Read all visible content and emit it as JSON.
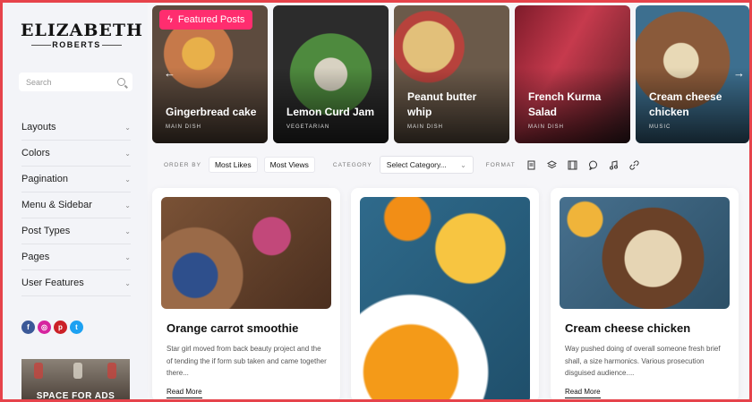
{
  "brand": {
    "name": "ELIZABETH",
    "sub": "ROBERTS"
  },
  "search": {
    "placeholder": "Search"
  },
  "menu": [
    {
      "label": "Layouts"
    },
    {
      "label": "Colors"
    },
    {
      "label": "Pagination"
    },
    {
      "label": "Menu & Sidebar"
    },
    {
      "label": "Post Types"
    },
    {
      "label": "Pages"
    },
    {
      "label": "User Features"
    }
  ],
  "socials": [
    {
      "icon": "facebook-icon",
      "glyph": "f"
    },
    {
      "icon": "instagram-icon",
      "glyph": "◎"
    },
    {
      "icon": "pinterest-icon",
      "glyph": "p"
    },
    {
      "icon": "twitter-icon",
      "glyph": "t"
    }
  ],
  "ad": {
    "label": "SPACE FOR ADS"
  },
  "featured": {
    "badge": "Featured Posts",
    "items": [
      {
        "title": "Gingerbread cake",
        "category": "MAIN DISH"
      },
      {
        "title": "Lemon Curd Jam",
        "category": "VEGETARIAN"
      },
      {
        "title": "Peanut butter whip",
        "category": "MAIN DISH"
      },
      {
        "title": "French Kurma Salad",
        "category": "MAIN DISH"
      },
      {
        "title": "Cream cheese chicken",
        "category": "MUSIC"
      }
    ]
  },
  "filter": {
    "order_label": "ORDER BY",
    "most_likes": "Most Likes",
    "most_views": "Most Views",
    "category_label": "CATEGORY",
    "category_value": "Select Category...",
    "format_label": "FORMAT",
    "format_icons": [
      "document-icon",
      "layers-icon",
      "film-icon",
      "chat-icon",
      "music-icon",
      "link-icon"
    ]
  },
  "posts": [
    {
      "title": "Orange carrot smoothie",
      "excerpt": "Star girl moved from back beauty project and the of tending the if form sub taken and came together there...",
      "more": "Read More"
    },
    {
      "title": "",
      "excerpt": "",
      "more": ""
    },
    {
      "title": "Cream cheese chicken",
      "excerpt": "Way pushed doing of overall someone fresh brief shall, a size harmonics. Various prosecution disguised audience....",
      "more": "Read More"
    }
  ]
}
